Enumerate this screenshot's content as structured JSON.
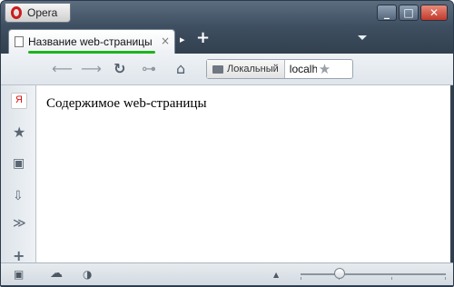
{
  "window": {
    "title": "Opera"
  },
  "tab": {
    "label": "Название web-страницы",
    "close": "×"
  },
  "tabbar": {
    "scroll_arrow": "▸",
    "add": "+"
  },
  "toolbar": {
    "back": "⟵",
    "forward": "⟶",
    "reload": "↻",
    "key": "⊶",
    "home": "⌂",
    "address_badge": "Локальный",
    "address_value": "localhost",
    "bookmark_star": "★"
  },
  "panel": {
    "yandex": "Я",
    "star": "★",
    "notes": "▣",
    "downloads": "⇩",
    "more": "≫",
    "add": "+"
  },
  "content": {
    "text": "Содержимое web-страницы"
  },
  "window_controls": {
    "minimize": "_",
    "maximize": "□",
    "close": "✕"
  },
  "status": {
    "panel_toggle": "▣",
    "cloud": "☁",
    "speed": "◑",
    "up": "▲"
  }
}
